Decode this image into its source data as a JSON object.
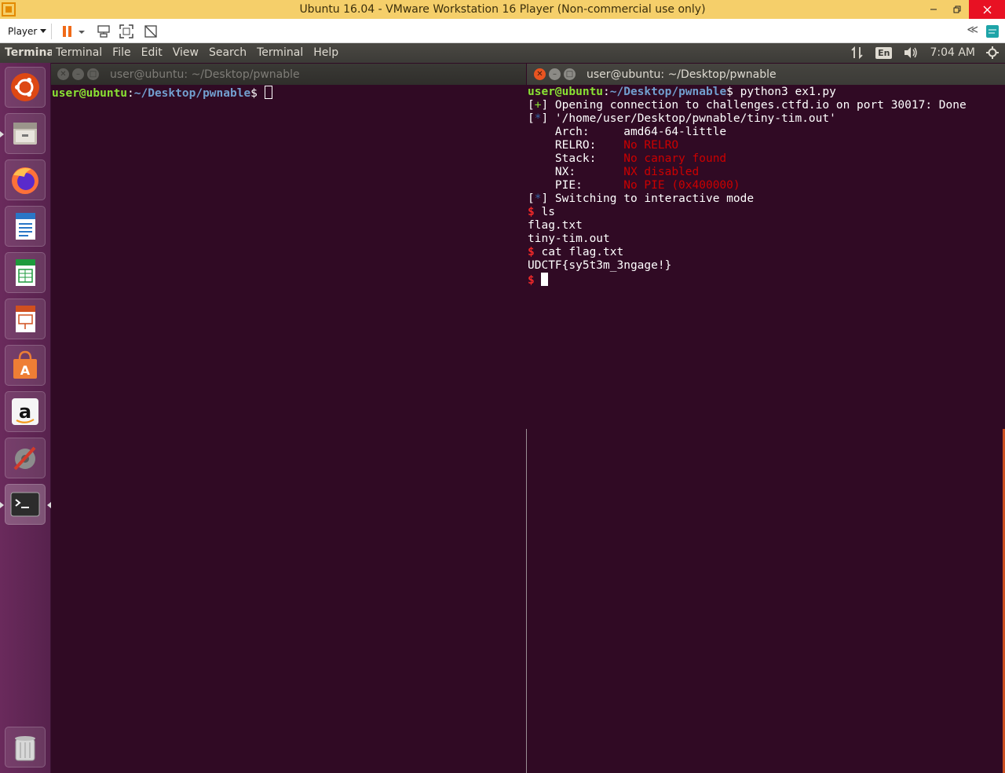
{
  "vm": {
    "title": "Ubuntu 16.04 - VMware Workstation 16 Player (Non-commercial use only)",
    "player_menu": "Player",
    "collapse_label": "≪"
  },
  "panel": {
    "app_name": "Terminal",
    "menus": [
      "Terminal",
      "File",
      "Edit",
      "View",
      "Search",
      "Terminal",
      "Help"
    ],
    "lang": "En",
    "clock": "7:04 AM"
  },
  "launcher": {
    "items": [
      "ubuntu-dash",
      "files",
      "firefox",
      "libreoffice-writer",
      "libreoffice-calc",
      "libreoffice-impress",
      "ubuntu-software",
      "amazon",
      "system-settings",
      "terminal"
    ],
    "trash": "trash"
  },
  "term_left": {
    "title": "user@ubuntu: ~/Desktop/pwnable",
    "prompt_user": "user@ubuntu",
    "prompt_path": "~/Desktop/pwnable",
    "prompt_sym": "$ "
  },
  "term_right": {
    "title": "user@ubuntu: ~/Desktop/pwnable",
    "prompt_user": "user@ubuntu",
    "prompt_path": "~/Desktop/pwnable",
    "prompt_sym": "$ ",
    "command": "python3 ex1.py",
    "lines": {
      "l1_tag": "+",
      "l1_text": " Opening connection to challenges.ctfd.io on port 30017: Done",
      "l2_tag": "*",
      "l2_text": " '/home/user/Desktop/pwnable/tiny-tim.out'",
      "arch_label": "    Arch:     ",
      "arch_val": "amd64-64-little",
      "relro_label": "    RELRO:    ",
      "relro_val": "No RELRO",
      "stack_label": "    Stack:    ",
      "stack_val": "No canary found",
      "nx_label": "    NX:       ",
      "nx_val": "NX disabled",
      "pie_label": "    PIE:      ",
      "pie_val": "No PIE (0x400000)",
      "l3_tag": "*",
      "l3_text": " Switching to interactive mode",
      "cmd_ls": "ls",
      "out_1": "flag.txt",
      "out_2": "tiny-tim.out",
      "cmd_cat": "cat flag.txt",
      "flag": "UDCTF{sy5t3m_3ngage!}"
    }
  }
}
